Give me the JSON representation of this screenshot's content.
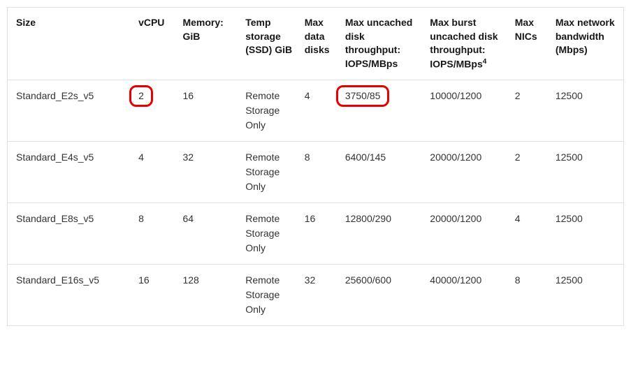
{
  "chart_data": {
    "type": "table",
    "columns": [
      "Size",
      "vCPU",
      "Memory: GiB",
      "Temp storage (SSD) GiB",
      "Max data disks",
      "Max uncached disk throughput: IOPS/MBps",
      "Max burst uncached disk throughput: IOPS/MBps",
      "Max NICs",
      "Max network bandwidth (Mbps)"
    ],
    "rows": [
      {
        "size": "Standard_E2s_v5",
        "vcpu": "2",
        "memory": "16",
        "temp": "Remote Storage Only",
        "disks": "4",
        "uncached": "3750/85",
        "burst": "10000/1200",
        "nics": "2",
        "bw": "12500"
      },
      {
        "size": "Standard_E4s_v5",
        "vcpu": "4",
        "memory": "32",
        "temp": "Remote Storage Only",
        "disks": "8",
        "uncached": "6400/145",
        "burst": "20000/1200",
        "nics": "2",
        "bw": "12500"
      },
      {
        "size": "Standard_E8s_v5",
        "vcpu": "8",
        "memory": "64",
        "temp": "Remote Storage Only",
        "disks": "16",
        "uncached": "12800/290",
        "burst": "20000/1200",
        "nics": "4",
        "bw": "12500"
      },
      {
        "size": "Standard_E16s_v5",
        "vcpu": "16",
        "memory": "128",
        "temp": "Remote Storage Only",
        "disks": "32",
        "uncached": "25600/600",
        "burst": "40000/1200",
        "nics": "8",
        "bw": "12500"
      }
    ],
    "footnote_marker": "4",
    "highlights": [
      {
        "row": 0,
        "column": "vcpu"
      },
      {
        "row": 0,
        "column": "uncached"
      }
    ]
  }
}
